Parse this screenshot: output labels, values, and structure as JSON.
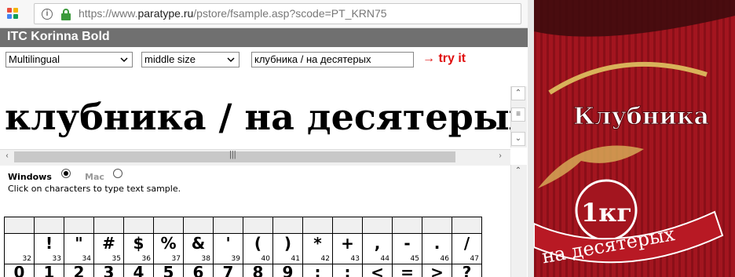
{
  "browser": {
    "url_prefix": "https://www.",
    "url_domain": "paratype.ru",
    "url_path": "/pstore/fsample.asp?scode=PT_KRN75"
  },
  "header": {
    "title": "ITC Korinna Bold"
  },
  "controls": {
    "charset_value": "Multilingual",
    "size_value": "middle size",
    "sample_text": "клубника / на десятерых",
    "try_label": "→ try it"
  },
  "sample": {
    "rendered_text": "клубника / на десятерых"
  },
  "platform": {
    "windows_label": "Windows",
    "mac_label": "Mac",
    "selected": "Windows"
  },
  "hint": "Click on characters to type text sample.",
  "char_grid": {
    "row1": [
      {
        "ch": "",
        "code": "32"
      },
      {
        "ch": "!",
        "code": "33"
      },
      {
        "ch": "\"",
        "code": "34"
      },
      {
        "ch": "#",
        "code": "35"
      },
      {
        "ch": "$",
        "code": "36"
      },
      {
        "ch": "%",
        "code": "37"
      },
      {
        "ch": "&",
        "code": "38"
      },
      {
        "ch": "'",
        "code": "39"
      },
      {
        "ch": "(",
        "code": "40"
      },
      {
        "ch": ")",
        "code": "41"
      },
      {
        "ch": "*",
        "code": "42"
      },
      {
        "ch": "+",
        "code": "43"
      },
      {
        "ch": ",",
        "code": "44"
      },
      {
        "ch": "-",
        "code": "45"
      },
      {
        "ch": ".",
        "code": "46"
      },
      {
        "ch": "/",
        "code": "47"
      }
    ],
    "row2": [
      "0",
      "1",
      "2",
      "3",
      "4",
      "5",
      "6",
      "7",
      "8",
      "9",
      ":",
      ";",
      "<",
      "=",
      ">",
      "?"
    ]
  },
  "package": {
    "product_name": "Клубника",
    "weight": "1кг",
    "ribbon_text": "на десятерых",
    "colors": {
      "red": "#a3151f",
      "stripe": "#8a0f18",
      "gold": "#d9b25a",
      "white": "#ffffff"
    }
  },
  "colors": {
    "title_bar": "#707070",
    "try_it": "#e01010",
    "lock": "#3c9a3c"
  }
}
